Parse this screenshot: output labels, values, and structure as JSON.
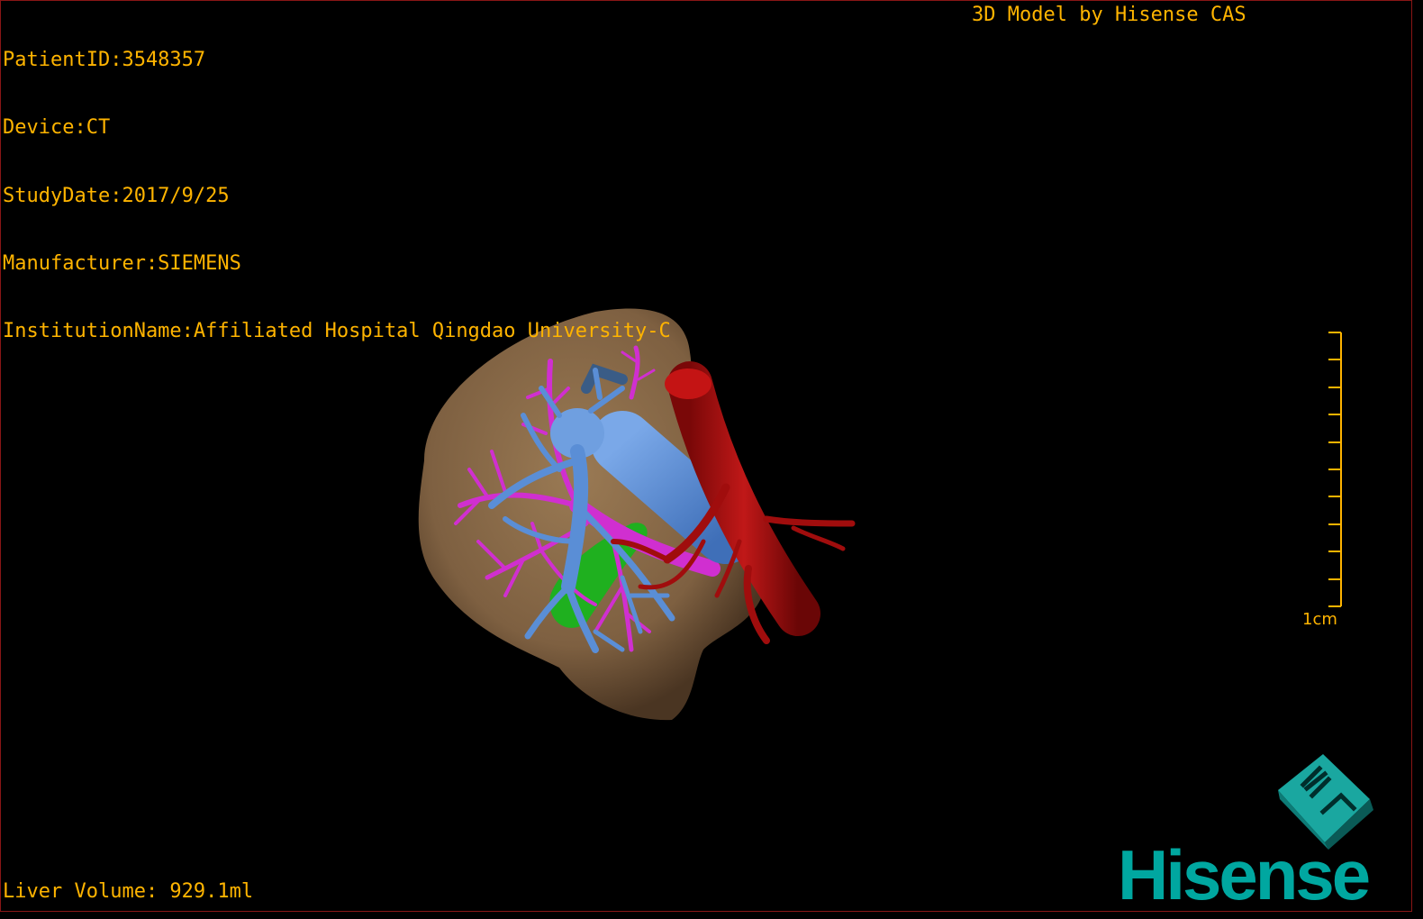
{
  "info": {
    "patient_id": "PatientID:3548357",
    "device": "Device:CT",
    "study_date": "StudyDate:2017/9/25",
    "manufacturer": "Manufacturer:SIEMENS",
    "institution": "InstitutionName:Affiliated Hospital Qingdao University-C"
  },
  "credit": "3D Model by Hisense CAS",
  "liver_volume": "Liver Volume: 929.1ml",
  "scale": {
    "label": "1cm",
    "color": "#ffb400"
  },
  "brand": {
    "name": "Hisense",
    "color": "#00a7a0"
  },
  "colors": {
    "text": "#ffb400",
    "liver": "#8a6a45",
    "portal_vein": "#5a8ed6",
    "hepatic_vein": "#d02fd0",
    "artery": "#a00d0d",
    "gallbladder": "#1fb01f",
    "border": "#8a1616"
  }
}
